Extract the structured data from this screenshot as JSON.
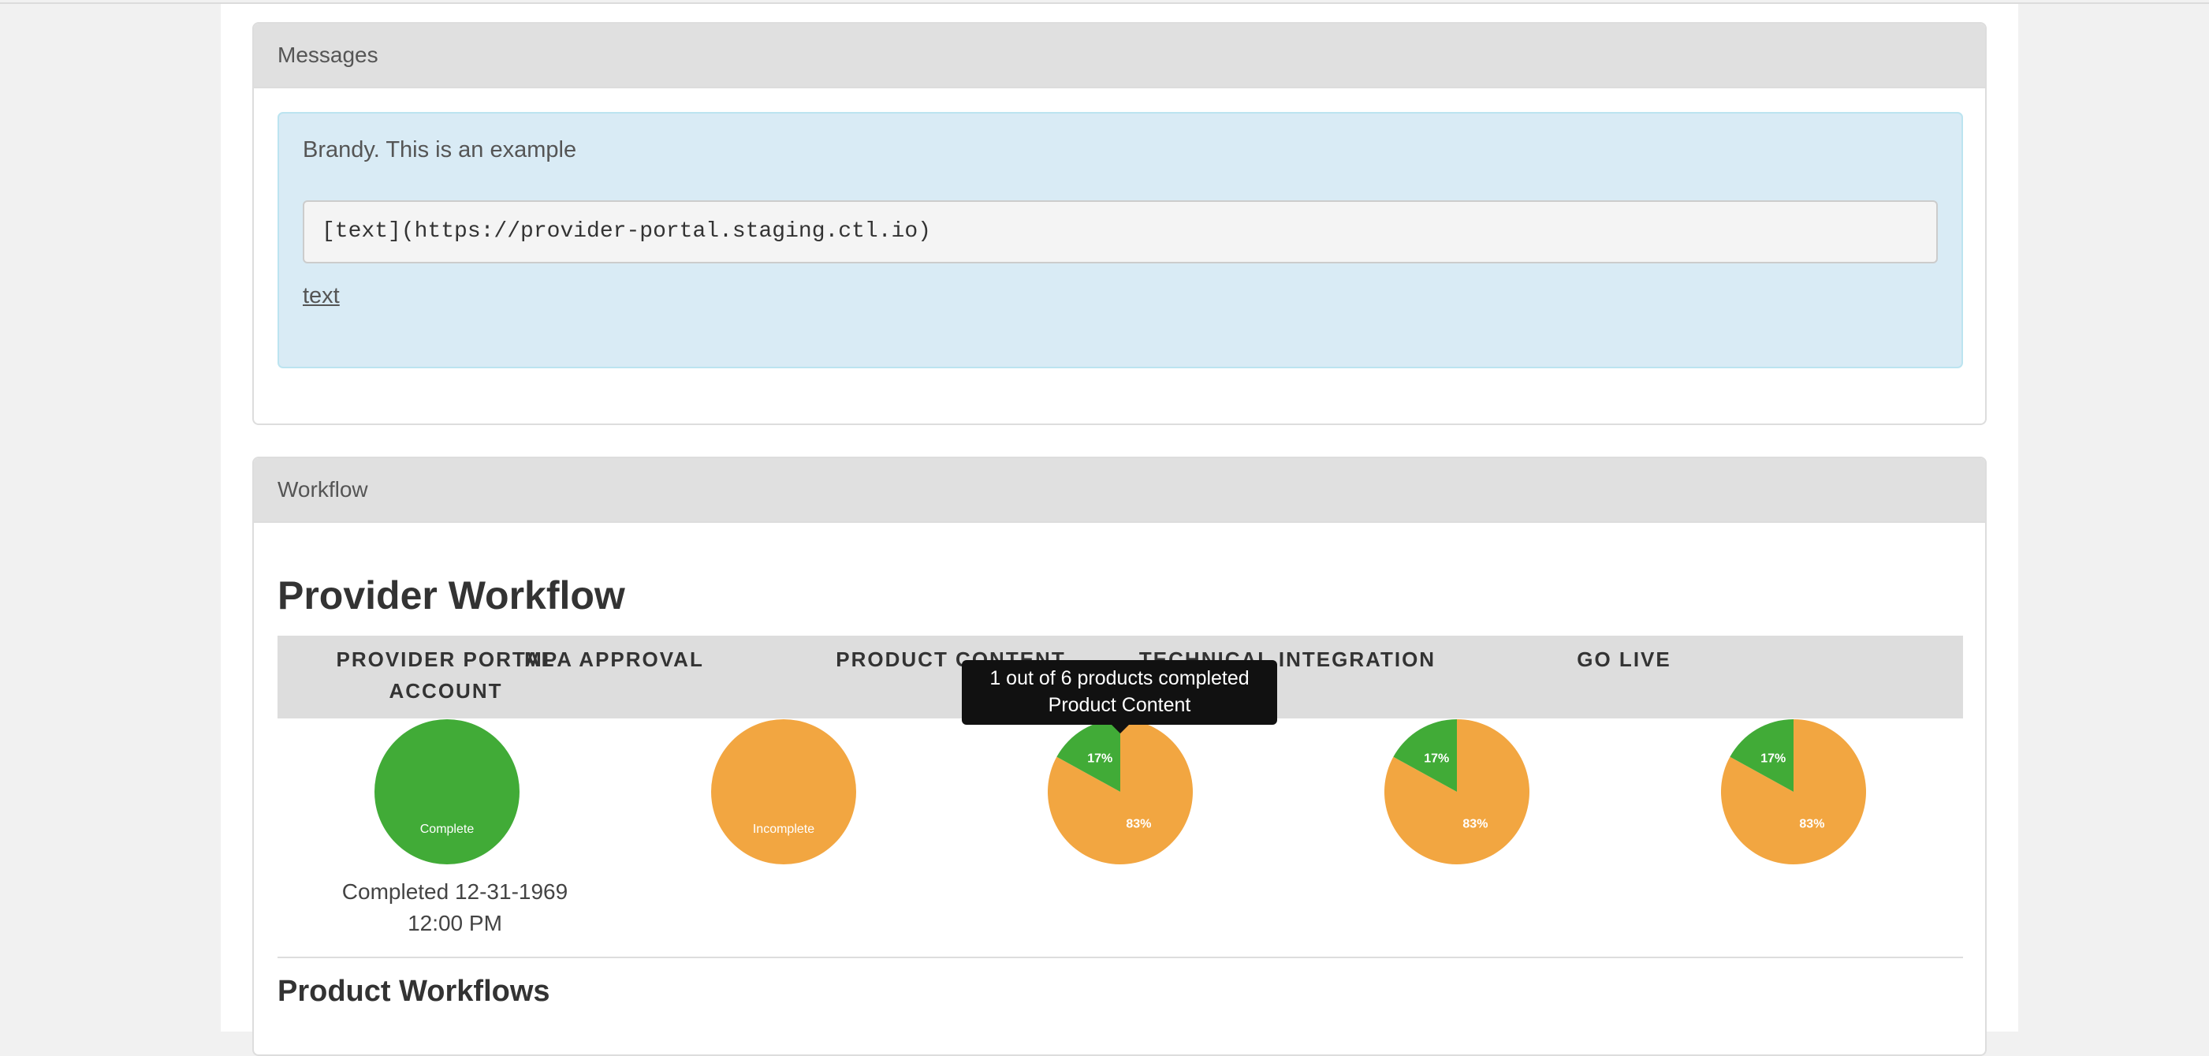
{
  "messages": {
    "heading": "Messages",
    "alert_text": "Brandy. This is an example",
    "code": "[text](https://provider-portal.staging.ctl.io)",
    "link_text": "text"
  },
  "workflow": {
    "heading": "Workflow",
    "title": "Provider Workflow",
    "stages": [
      {
        "label": "PROVIDER PORTAL ACCOUNT",
        "status": "complete",
        "pie_label": "Complete",
        "completed_note": "Completed 12-31-1969 12:00 PM"
      },
      {
        "label": "MPA APPROVAL",
        "status": "incomplete",
        "pie_label": "Incomplete"
      },
      {
        "label": "PRODUCT CONTENT",
        "status": "partial",
        "complete_percent": 17,
        "incomplete_percent": 83,
        "complete_label": "17%",
        "incomplete_label": "83%"
      },
      {
        "label": "TECHNICAL INTEGRATION",
        "status": "partial",
        "complete_percent": 17,
        "incomplete_percent": 83,
        "complete_label": "17%",
        "incomplete_label": "83%"
      },
      {
        "label": "GO LIVE",
        "status": "partial",
        "complete_percent": 17,
        "incomplete_percent": 83,
        "complete_label": "17%",
        "incomplete_label": "83%"
      }
    ],
    "product_workflows_title": "Product Workflows"
  },
  "tooltip": {
    "line1": "1 out of 6 products completed",
    "line2": "Product Content"
  },
  "colors": {
    "complete": "#41ab37",
    "incomplete": "#f2a641"
  }
}
